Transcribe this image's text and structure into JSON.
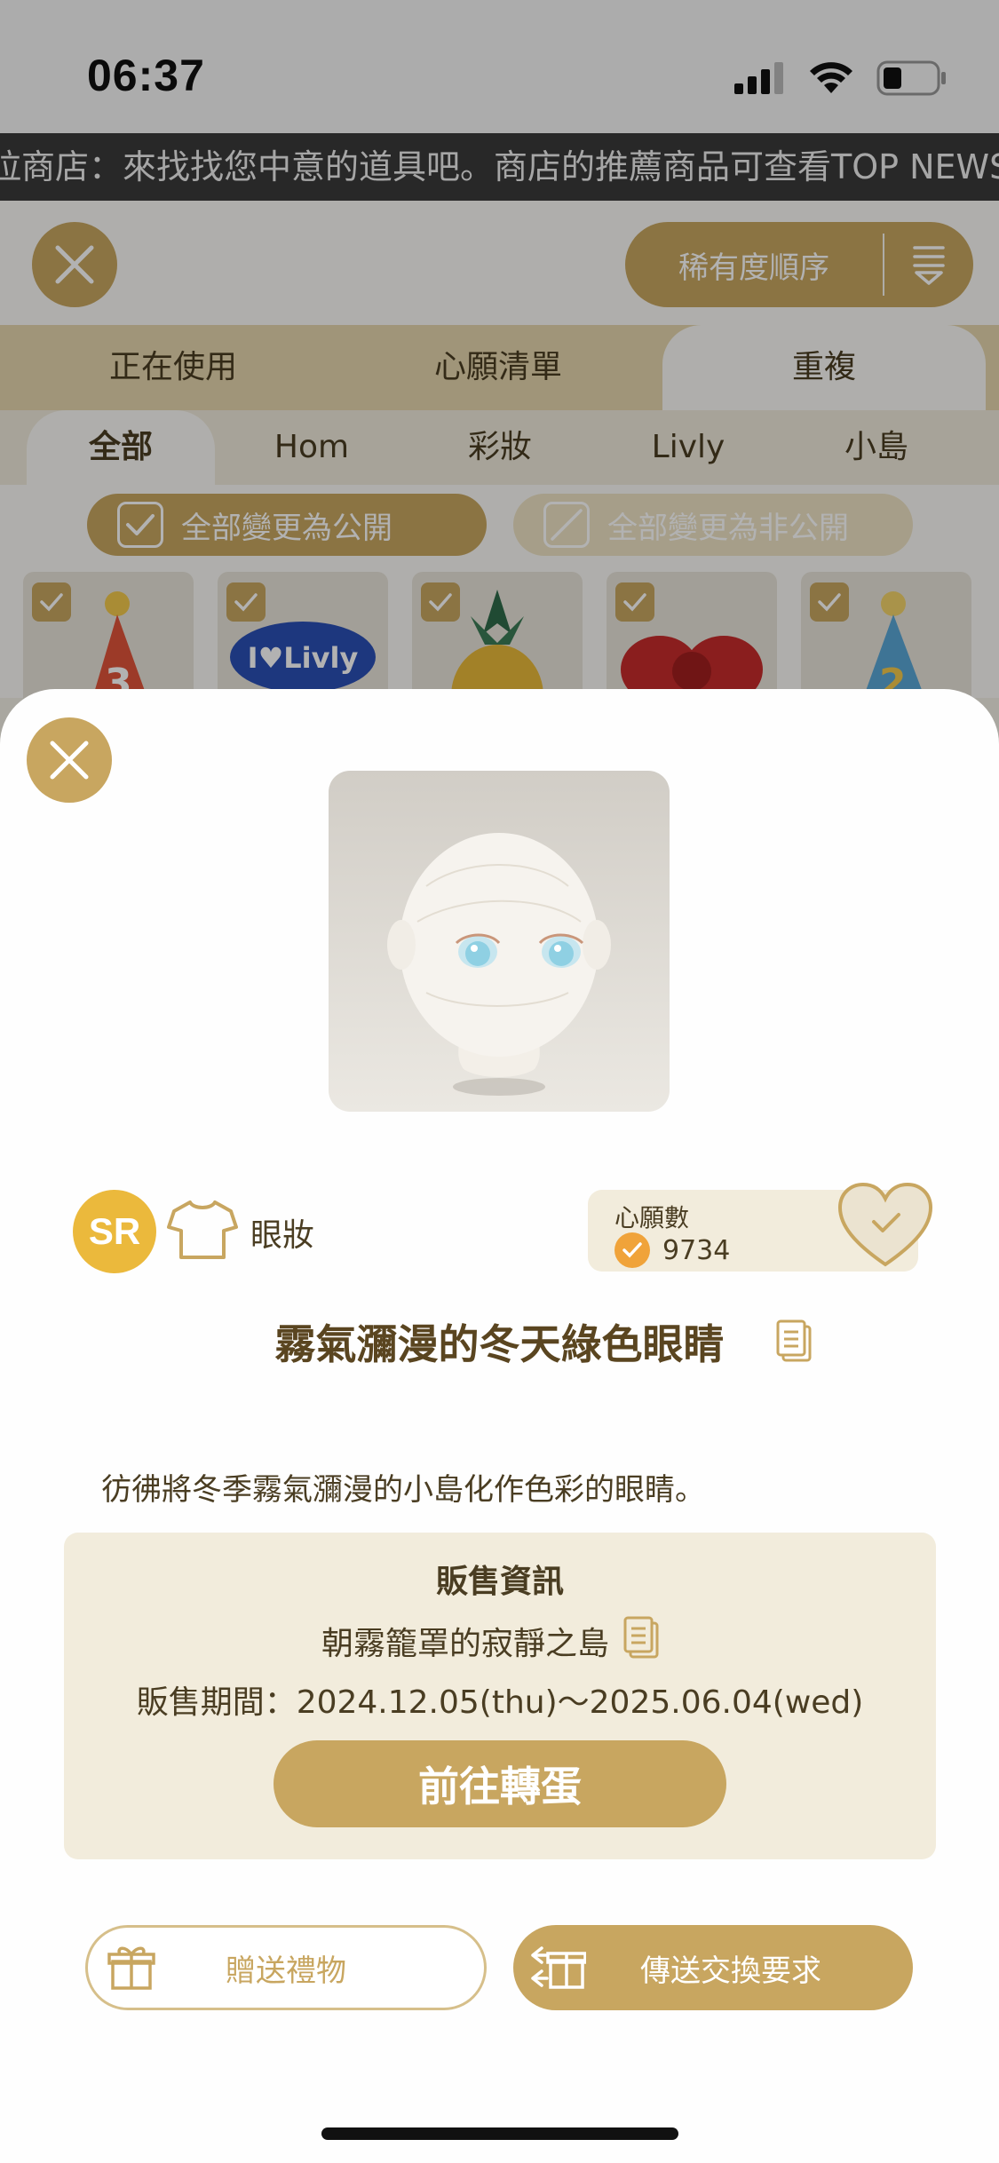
{
  "status_bar": {
    "time": "06:37"
  },
  "ticker": {
    "text": "拉商店：來找找您中意的道具吧。商店的推薦商品可查看TOP NEWS。"
  },
  "shop": {
    "sort_label": "稀有度順序",
    "tabs": [
      {
        "label": "正在使用"
      },
      {
        "label": "心願清單"
      },
      {
        "label": "重複"
      }
    ],
    "subtabs": [
      {
        "label": "全部"
      },
      {
        "label": "Hom"
      },
      {
        "label": "彩妝"
      },
      {
        "label": "Livly"
      },
      {
        "label": "小島"
      }
    ],
    "make_public_label": "全部變更為公開",
    "make_private_label": "全部變更為非公開",
    "thumb_text": "I♥Livly"
  },
  "item": {
    "rarity": "SR",
    "category": "眼妝",
    "wishlist_title": "心願數",
    "wishlist_count": "9734",
    "name": "霧氣瀰漫的冬天綠色眼睛",
    "description": "彷彿將冬季霧氣瀰漫的小島化作色彩的眼睛。"
  },
  "sale": {
    "title": "販售資訊",
    "island": "朝霧籠罩的寂靜之島",
    "period": "販售期間：2024.12.05(thu)～2025.06.04(wed)",
    "gacha_button": "前往轉蛋"
  },
  "actions": {
    "gift_label": "贈送禮物",
    "trade_label": "傳送交換要求"
  },
  "colors": {
    "gold": "#c8a660",
    "panel": "#f2ecdc",
    "rarity_sr": "#ebb93c",
    "wish_badge": "#f0a33a"
  }
}
